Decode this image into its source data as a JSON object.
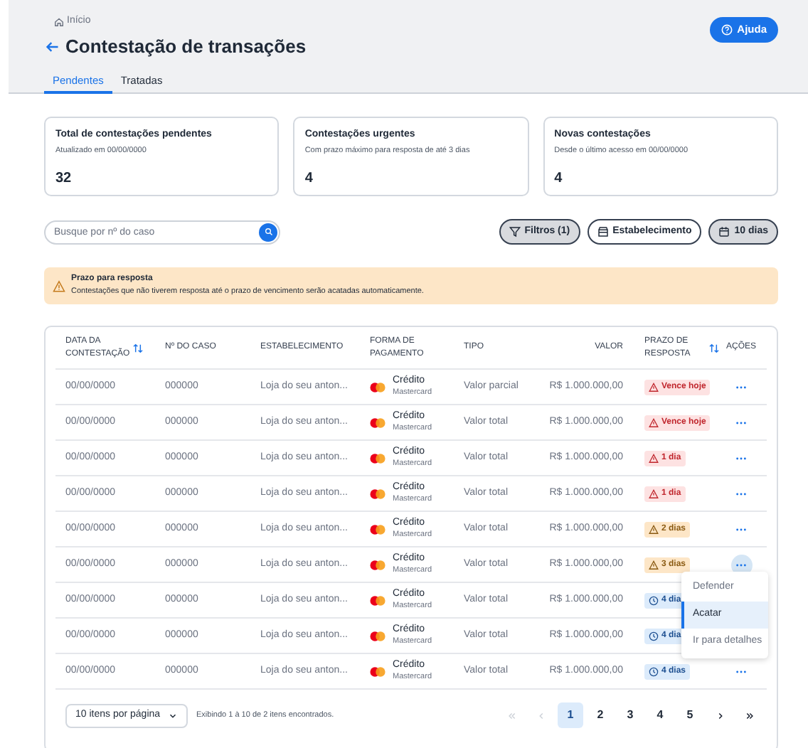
{
  "breadcrumb": "Início",
  "title": "Contestação de transações",
  "help_button": "Ajuda",
  "tabs": [
    {
      "label": "Pendentes",
      "selected": true
    },
    {
      "label": "Tratadas",
      "selected": false
    }
  ],
  "cards": [
    {
      "title": "Total de contestações pendentes",
      "subtitle": "Atualizado em 00/00/0000",
      "value": "32"
    },
    {
      "title": "Contestações urgentes",
      "subtitle": "Com prazo máximo para resposta de até 3 dias",
      "value": "4"
    },
    {
      "title": "Novas contestações",
      "subtitle": "Desde o último acesso em 00/00/0000",
      "value": "4"
    }
  ],
  "search": {
    "placeholder": "Busque por nº do caso"
  },
  "filters": [
    {
      "kind": "filter",
      "label": "Filtros (1)",
      "selected": true
    },
    {
      "kind": "store",
      "label": "Estabelecimento",
      "selected": false
    },
    {
      "kind": "calendar",
      "label": "10 dias",
      "selected": true
    }
  ],
  "alert": {
    "title": "Prazo para resposta",
    "text": "Contestações que não tiverem resposta até o prazo de vencimento serão acatadas automaticamente."
  },
  "table": {
    "columns": [
      {
        "label": "DATA DA CONTESTAÇÃO",
        "sortable": true
      },
      {
        "label": "Nº DO CASO",
        "sortable": false
      },
      {
        "label": "ESTABELECIMENTO",
        "sortable": false
      },
      {
        "label": "FORMA DE PAGAMENTO",
        "sortable": false
      },
      {
        "label": "TIPO",
        "sortable": false
      },
      {
        "label": "VALOR",
        "sortable": false
      },
      {
        "label": "PRAZO DE RESPOSTA",
        "sortable": true
      },
      {
        "label": "AÇÕES",
        "sortable": false
      }
    ],
    "rows": [
      {
        "date": "00/00/0000",
        "case": "000000",
        "store": "Loja do seu anton...",
        "payment": "Crédito",
        "brand": "Mastercard",
        "type": "Valor parcial",
        "value": "R$ 1.000.000,00",
        "deadline": {
          "kind": "danger",
          "label": "Vence hoje"
        },
        "menu_open": false
      },
      {
        "date": "00/00/0000",
        "case": "000000",
        "store": "Loja do seu anton...",
        "payment": "Crédito",
        "brand": "Mastercard",
        "type": "Valor total",
        "value": "R$ 1.000.000,00",
        "deadline": {
          "kind": "danger",
          "label": "Vence hoje"
        },
        "menu_open": false
      },
      {
        "date": "00/00/0000",
        "case": "000000",
        "store": "Loja do seu anton...",
        "payment": "Crédito",
        "brand": "Mastercard",
        "type": "Valor total",
        "value": "R$ 1.000.000,00",
        "deadline": {
          "kind": "danger",
          "label": "1 dia"
        },
        "menu_open": false
      },
      {
        "date": "00/00/0000",
        "case": "000000",
        "store": "Loja do seu anton...",
        "payment": "Crédito",
        "brand": "Mastercard",
        "type": "Valor total",
        "value": "R$ 1.000.000,00",
        "deadline": {
          "kind": "danger",
          "label": "1 dia"
        },
        "menu_open": false
      },
      {
        "date": "00/00/0000",
        "case": "000000",
        "store": "Loja do seu anton...",
        "payment": "Crédito",
        "brand": "Mastercard",
        "type": "Valor total",
        "value": "R$ 1.000.000,00",
        "deadline": {
          "kind": "warning",
          "label": "2 dias"
        },
        "menu_open": false
      },
      {
        "date": "00/00/0000",
        "case": "000000",
        "store": "Loja do seu anton...",
        "payment": "Crédito",
        "brand": "Mastercard",
        "type": "Valor total",
        "value": "R$ 1.000.000,00",
        "deadline": {
          "kind": "warning",
          "label": "3 dias"
        },
        "menu_open": true
      },
      {
        "date": "00/00/0000",
        "case": "000000",
        "store": "Loja do seu anton...",
        "payment": "Crédito",
        "brand": "Mastercard",
        "type": "Valor total",
        "value": "R$ 1.000.000,00",
        "deadline": {
          "kind": "info",
          "label": "4 dia"
        }
      },
      {
        "date": "00/00/0000",
        "case": "000000",
        "store": "Loja do seu anton...",
        "payment": "Crédito",
        "brand": "Mastercard",
        "type": "Valor total",
        "value": "R$ 1.000.000,00",
        "deadline": {
          "kind": "info",
          "label": "4 dia"
        }
      },
      {
        "date": "00/00/0000",
        "case": "000000",
        "store": "Loja do seu anton...",
        "payment": "Crédito",
        "brand": "Mastercard",
        "type": "Valor total",
        "value": "R$ 1.000.000,00",
        "deadline": {
          "kind": "info",
          "label": "4 dias"
        },
        "menu_open": false
      }
    ]
  },
  "action_menu": [
    {
      "label": "Defender",
      "selected": false
    },
    {
      "label": "Acatar",
      "selected": true
    },
    {
      "label": "Ir para detalhes",
      "selected": false
    }
  ],
  "pagination": {
    "page_size": "10 itens por página",
    "summary": "Exibindo 1 à 10 de 2 itens encontrados.",
    "buttons": [
      {
        "kind": "first",
        "disabled": true
      },
      {
        "kind": "prev",
        "disabled": true
      },
      {
        "kind": "page",
        "label": "1",
        "selected": true
      },
      {
        "kind": "page",
        "label": "2",
        "selected": false
      },
      {
        "kind": "page",
        "label": "3",
        "selected": false
      },
      {
        "kind": "page",
        "label": "4",
        "selected": false
      },
      {
        "kind": "page",
        "label": "5",
        "selected": false
      },
      {
        "kind": "next",
        "disabled": false
      },
      {
        "kind": "last",
        "disabled": false
      }
    ]
  }
}
